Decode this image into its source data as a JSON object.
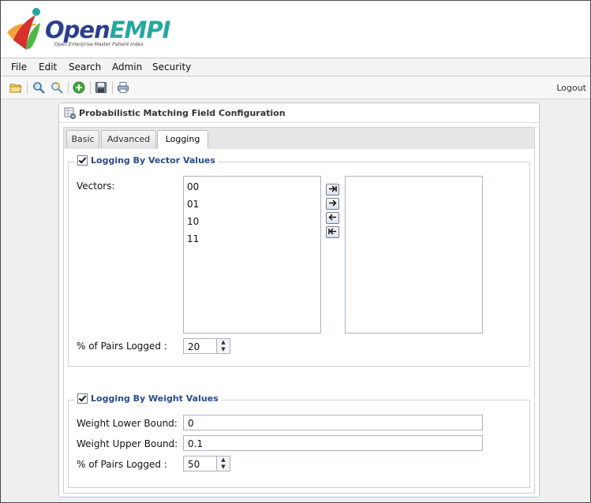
{
  "branding": {
    "logo_primary": "Open",
    "logo_accent": "EMPI",
    "logo_subtitle": "Open Enterprise Master Patient Index",
    "colors": {
      "primary": "#2b3f8c",
      "accent": "#25a7a0",
      "flame_orange": "#f2a23a",
      "flame_red": "#d6312f",
      "flame_green": "#4db848"
    }
  },
  "menubar": {
    "items": [
      {
        "label": "File"
      },
      {
        "label": "Edit"
      },
      {
        "label": "Search"
      },
      {
        "label": "Admin"
      },
      {
        "label": "Security"
      }
    ]
  },
  "toolbar": {
    "icons": [
      "open-folder-icon",
      "search-icon",
      "advanced-search-icon",
      "add-icon",
      "save-icon",
      "print-icon"
    ],
    "logout_label": "Logout"
  },
  "panel": {
    "title": "Probabilistic Matching Field Configuration",
    "icon": "settings-grid-icon",
    "tabs": [
      {
        "label": "Basic",
        "active": false
      },
      {
        "label": "Advanced",
        "active": false
      },
      {
        "label": "Logging",
        "active": true
      }
    ]
  },
  "vector_logging": {
    "legend": "Logging By Vector Values",
    "checked": true,
    "vectors_label": "Vectors:",
    "available": [
      "00",
      "01",
      "10",
      "11"
    ],
    "selected": [],
    "pairs_label": "% of Pairs Logged :",
    "pairs_value": "20"
  },
  "weight_logging": {
    "legend": "Logging By Weight Values",
    "checked": true,
    "lower_label": "Weight Lower Bound:",
    "lower_value": "0",
    "upper_label": "Weight Upper Bound:",
    "upper_value": "0.1",
    "pairs_label": "% of Pairs Logged :",
    "pairs_value": "50"
  }
}
